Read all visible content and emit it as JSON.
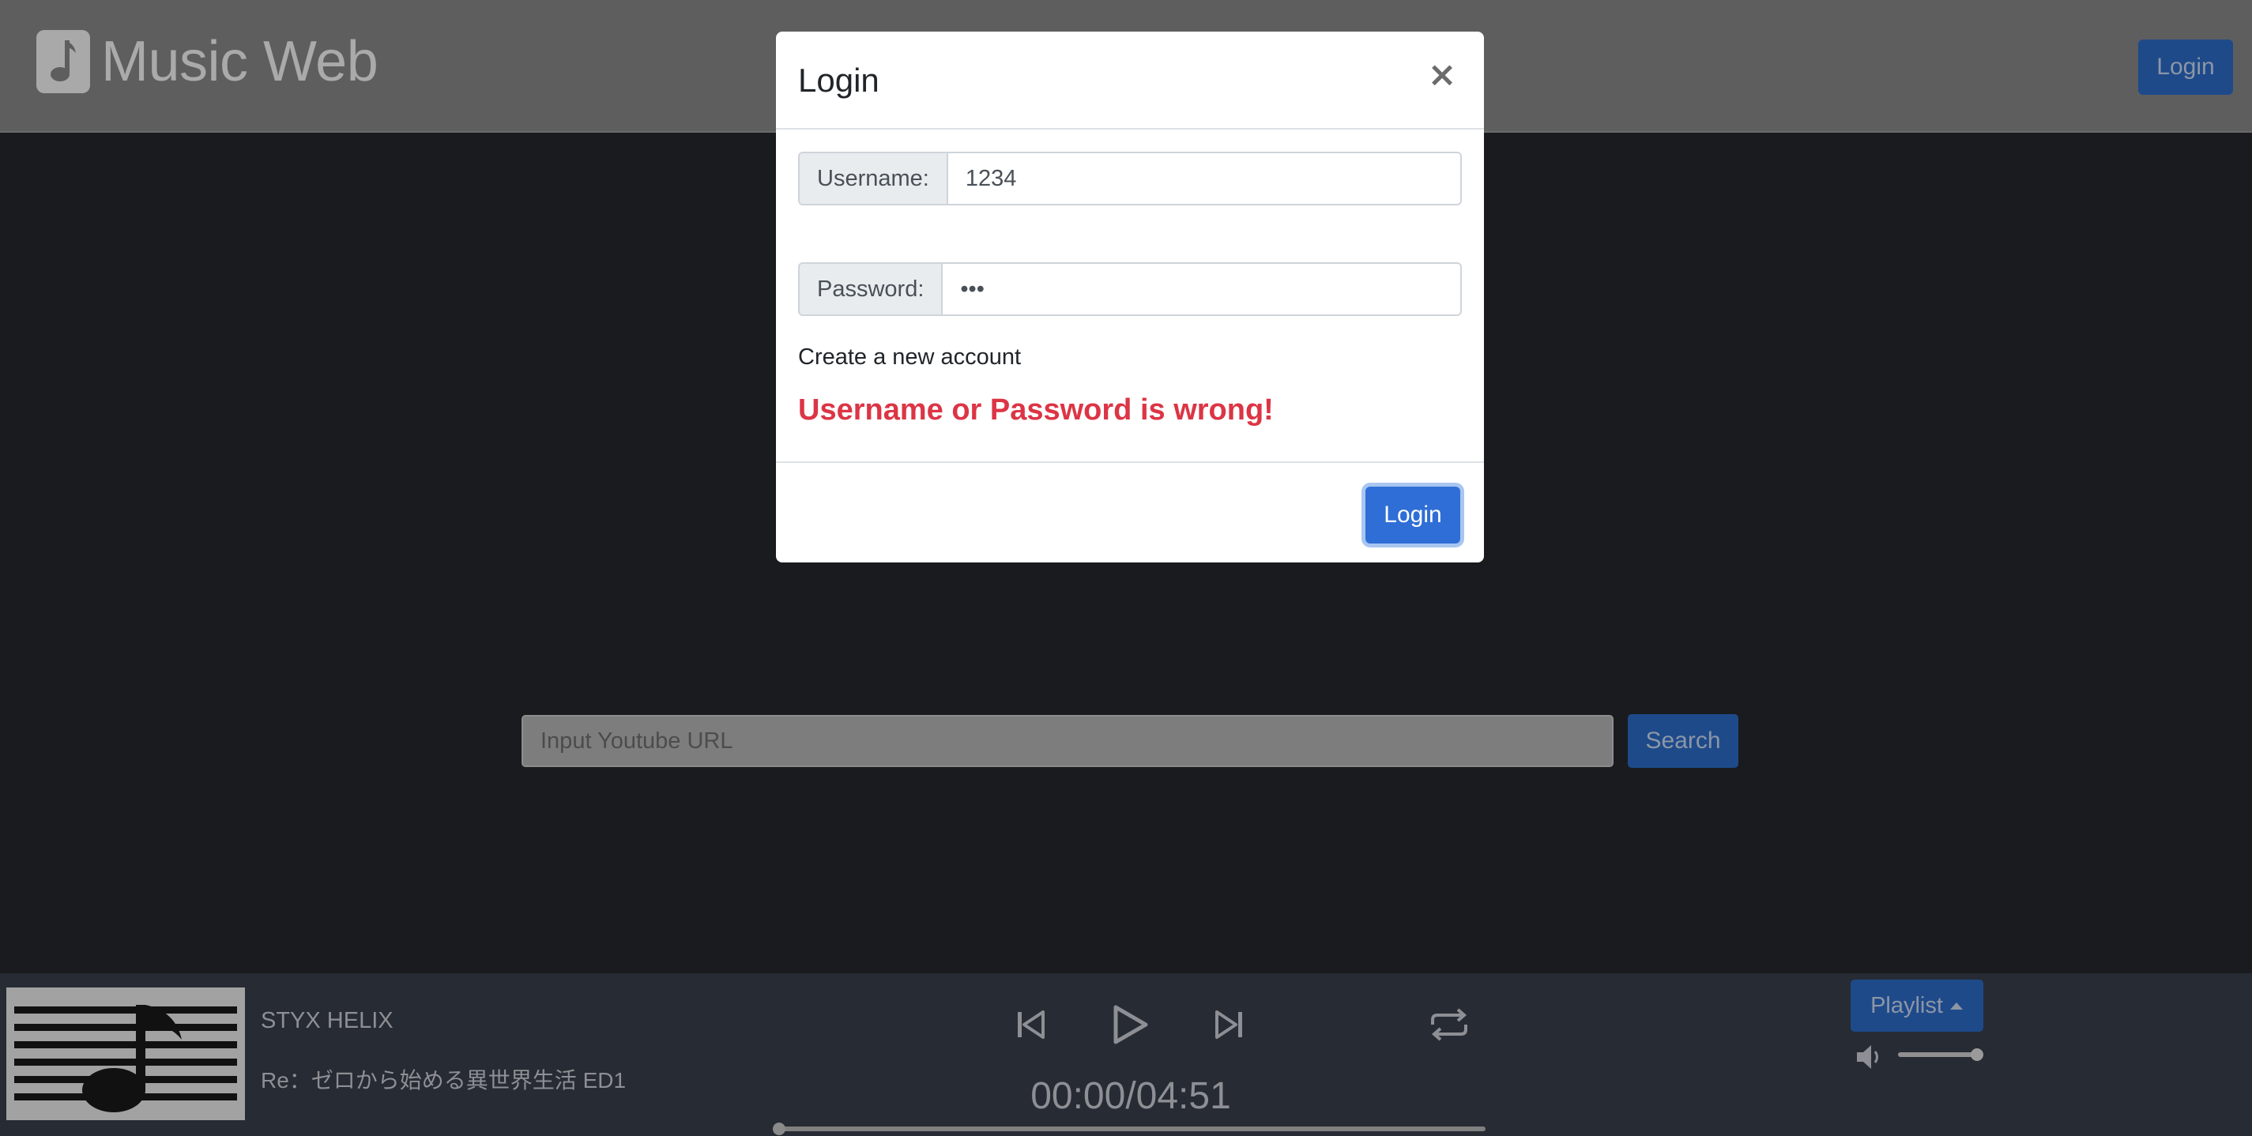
{
  "navbar": {
    "brand_name": "Music Web",
    "brand_icon": "music-note-icon",
    "login_label": "Login"
  },
  "search": {
    "placeholder": "Input Youtube URL",
    "button_label": "Search"
  },
  "player": {
    "cover_icon": "music-score-icon",
    "song_title": "STYX HELIX",
    "song_subtitle": "Re：ゼロから始める異世界生活 ED1",
    "time_display": "00:00/04:51",
    "progress_fraction": 0.0,
    "playlist_label": "Playlist",
    "volume_fraction": 1.0
  },
  "modal": {
    "title": "Login",
    "close_glyph": "×",
    "username_label": "Username:",
    "username_value": "1234",
    "password_label": "Password:",
    "password_value": "123",
    "create_account": "Create a new account",
    "error": "Username or Password is wrong!",
    "login_label": "Login"
  },
  "colors": {
    "primary": "#2f6ed6",
    "error": "#dc3545",
    "navbar": "#5e5e5f",
    "background": "#1a1b1f",
    "player_bar": "#272b33"
  }
}
